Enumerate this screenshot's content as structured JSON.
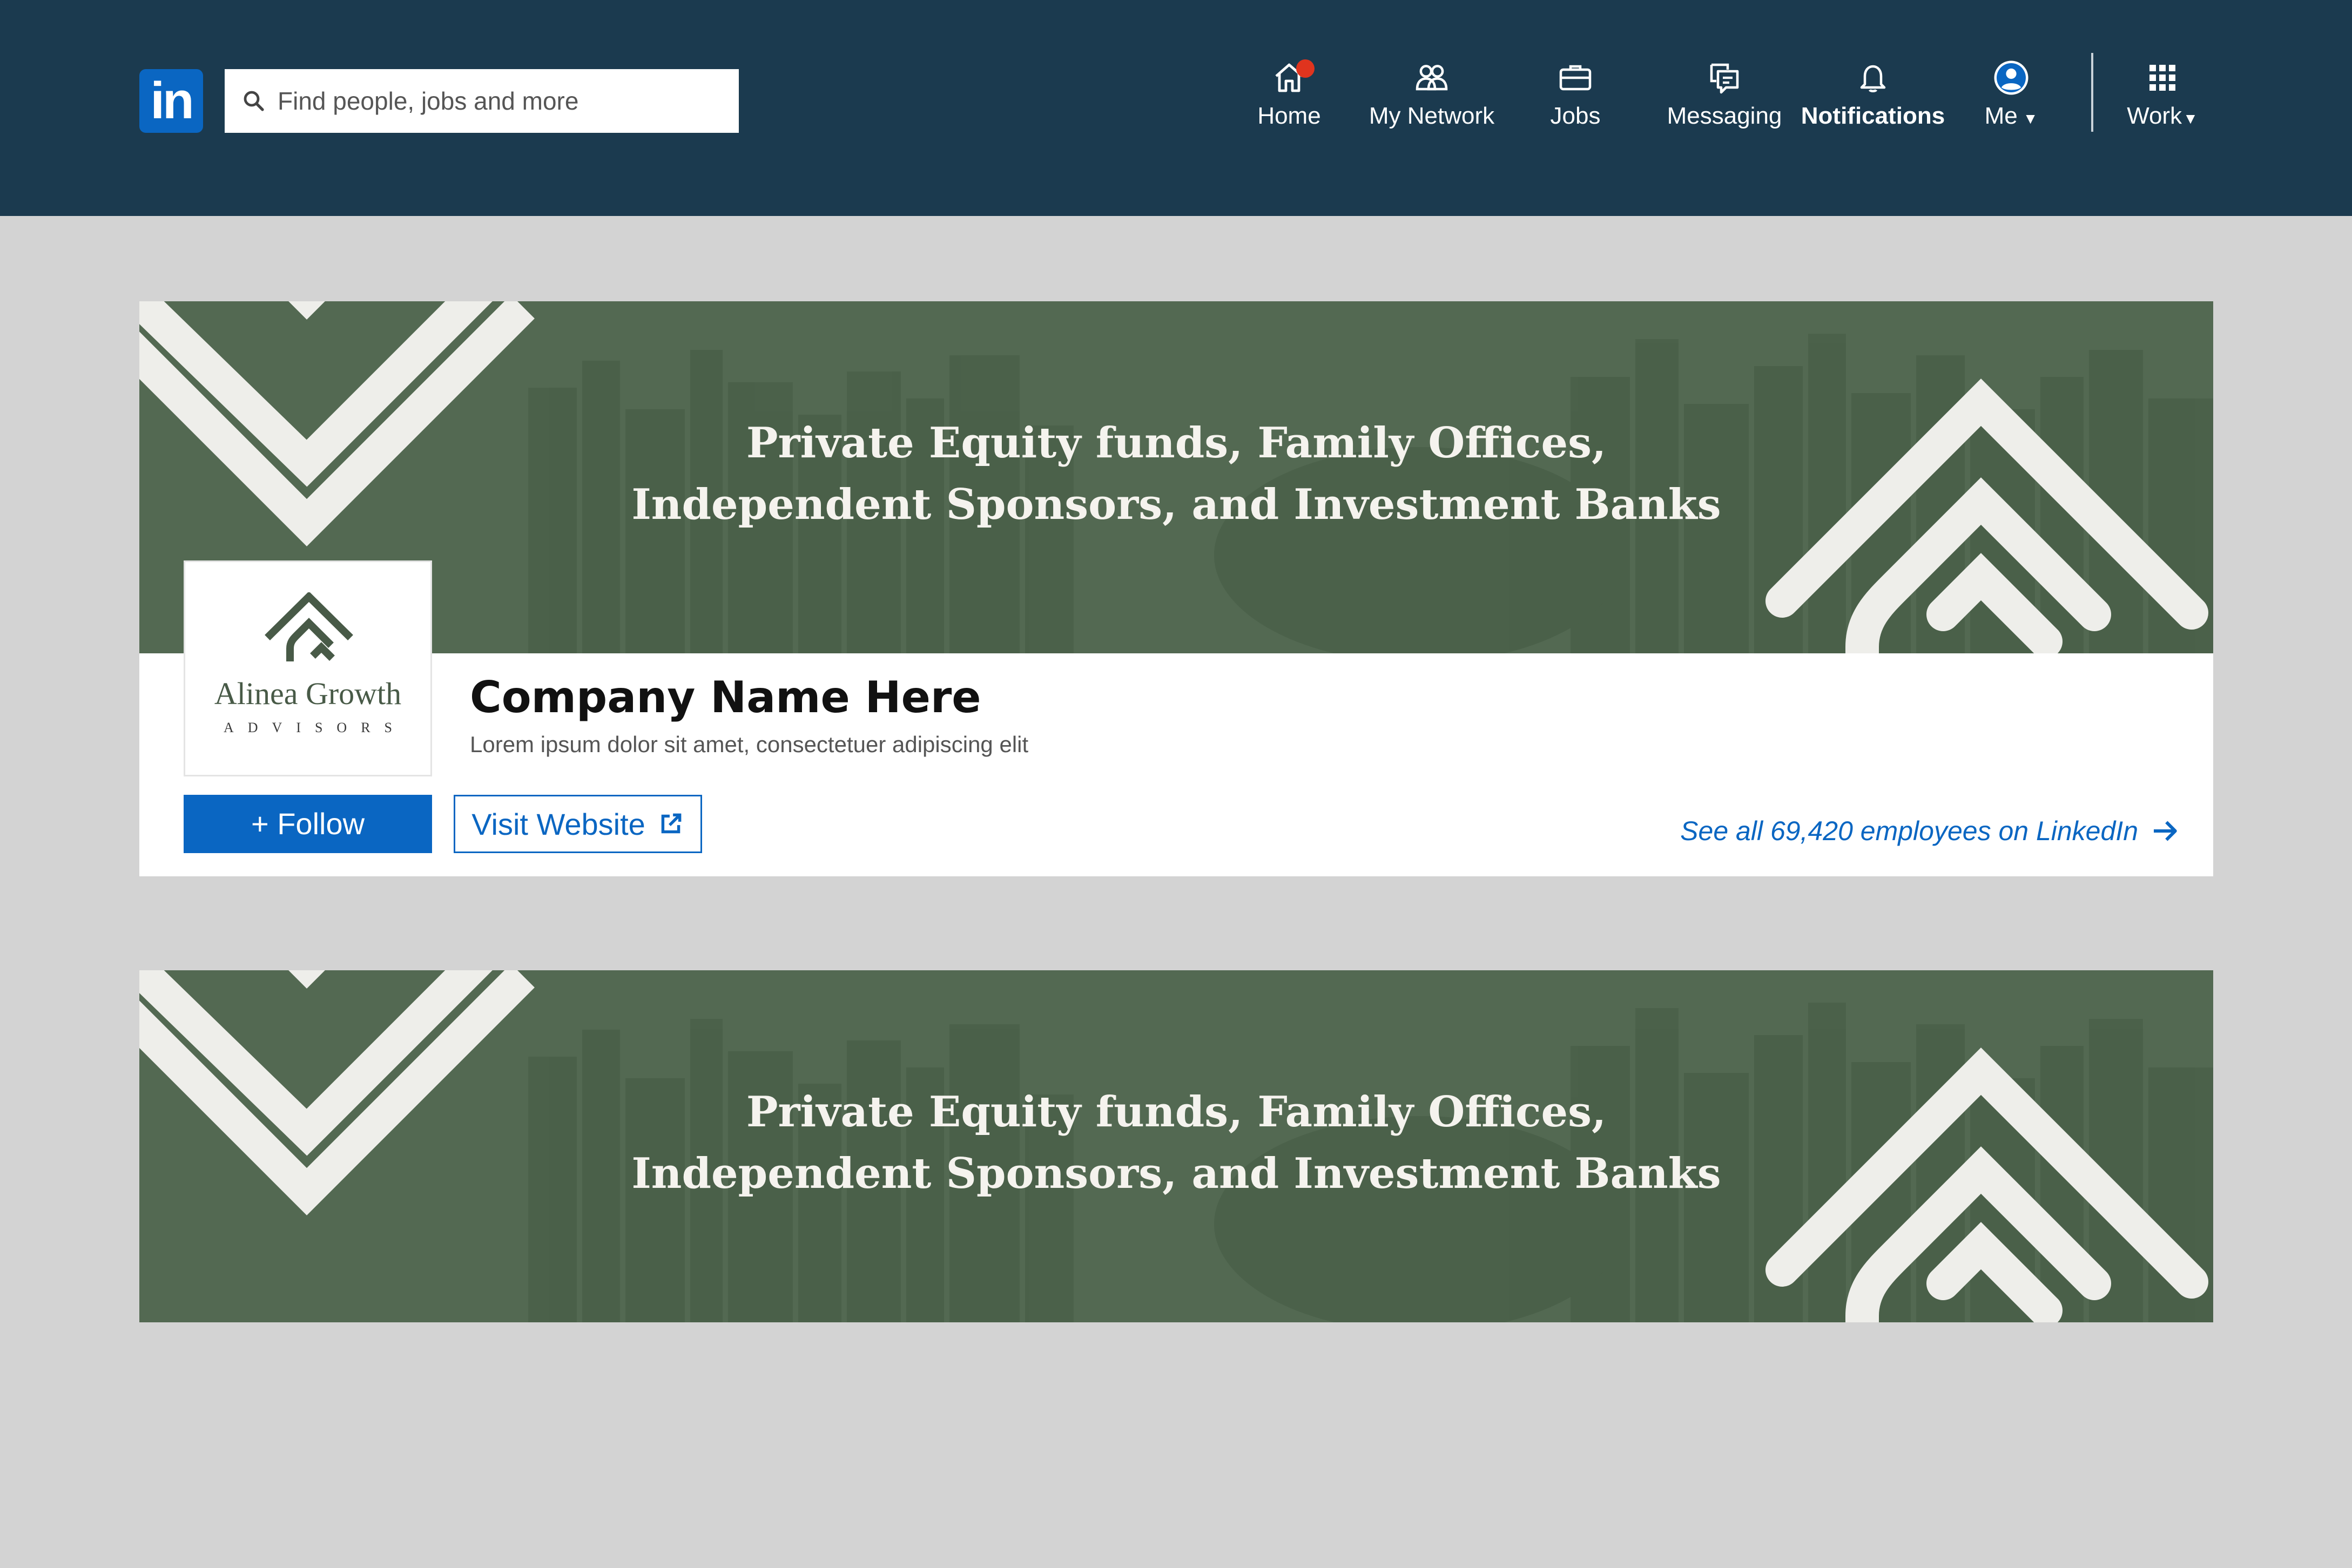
{
  "nav": {
    "logo_text": "in",
    "search_placeholder": "Find people, jobs and more",
    "items": [
      {
        "label": "Home",
        "icon": "home-icon",
        "has_badge": true
      },
      {
        "label": "My Network",
        "icon": "network-icon"
      },
      {
        "label": "Jobs",
        "icon": "briefcase-icon"
      },
      {
        "label": "Messaging",
        "icon": "messaging-icon"
      },
      {
        "label": "Notifications",
        "icon": "bell-icon",
        "active": true
      },
      {
        "label": "Me",
        "icon": "avatar-icon"
      },
      {
        "label": "Work",
        "icon": "grid-icon"
      }
    ]
  },
  "banner": {
    "line1": "Private Equity funds, Family Offices,",
    "line2": "Independent Sponsors, and Investment Banks"
  },
  "company_logo": {
    "name": "Alinea Growth",
    "subtitle": "ADVISORS"
  },
  "company": {
    "name": "Company Name Here",
    "description": "Lorem ipsum dolor sit amet, consectetuer adipiscing elit"
  },
  "actions": {
    "follow_label": "+ Follow",
    "visit_label": "Visit Website",
    "employees_link": "See all 69,420 employees on LinkedIn"
  },
  "colors": {
    "nav_bg": "#1b3a4f",
    "banner_green": "#536952",
    "linkedin_blue": "#0a66c2",
    "badge_red": "#e0341e",
    "page_bg": "#d3d3d3"
  }
}
